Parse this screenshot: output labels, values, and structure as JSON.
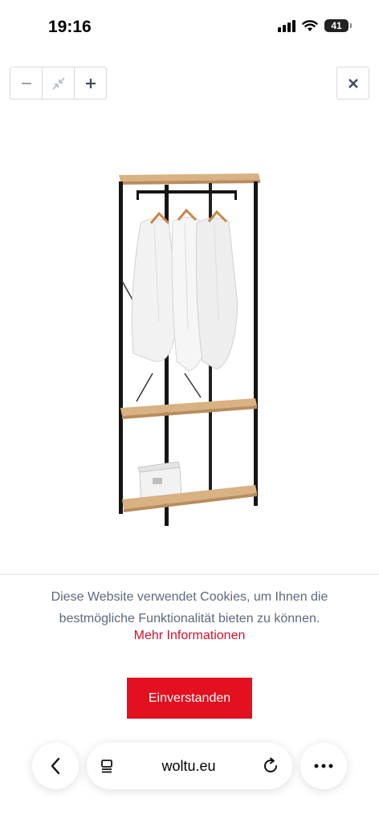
{
  "status_bar": {
    "time": "19:16",
    "battery": "41",
    "icons": [
      "signal-icon",
      "wifi-icon",
      "battery-icon"
    ]
  },
  "viewer": {
    "icons": [
      "zoom-out-icon",
      "fit-screen-icon",
      "zoom-in-icon",
      "close-icon"
    ]
  },
  "product_image": {
    "subject": "black metal clothes rack with wooden shelves"
  },
  "cookie_banner": {
    "text": "Diese Website verwendet Cookies, um Ihnen die bestmögliche Funktionalität bieten zu können.",
    "more_link": "Mehr Informationen",
    "accept_label": "Einverstanden",
    "accent_color": "#e3101f"
  },
  "browser_bar": {
    "url": "woltu.eu",
    "icons": [
      "back-icon",
      "tabs-icon",
      "reload-icon",
      "more-icon"
    ]
  }
}
